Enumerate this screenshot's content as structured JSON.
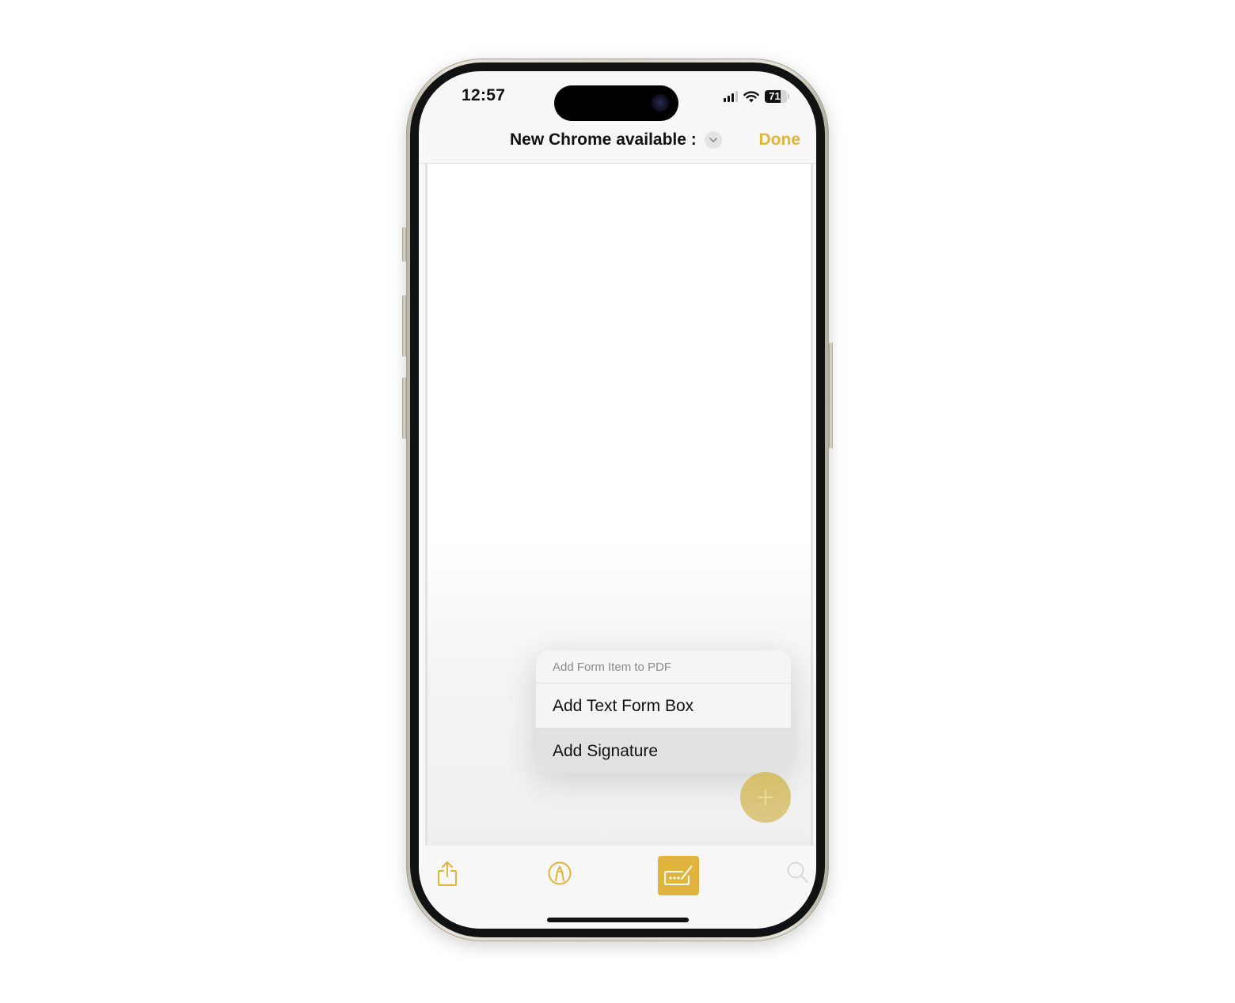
{
  "status_bar": {
    "time": "12:57",
    "battery_percent": "71",
    "battery_level": 0.71,
    "signal_bars_active": 3,
    "signal_bars_total": 4
  },
  "nav": {
    "title": "New Chrome available :",
    "done_label": "Done"
  },
  "menu": {
    "header": "Add Form Item to PDF",
    "items": [
      {
        "label": "Add Text Form Box",
        "highlighted": false
      },
      {
        "label": "Add Signature",
        "highlighted": true
      }
    ]
  },
  "toolbar": {
    "items": [
      {
        "icon": "share-icon",
        "active": false
      },
      {
        "icon": "markup-pen-icon",
        "active": false
      },
      {
        "icon": "form-fill-icon",
        "active": true
      },
      {
        "icon": "search-icon",
        "active": false
      }
    ]
  },
  "colors": {
    "accent": "#e0b43d",
    "fab": "#d9c378",
    "menu_highlight": "#e2e2e2"
  }
}
